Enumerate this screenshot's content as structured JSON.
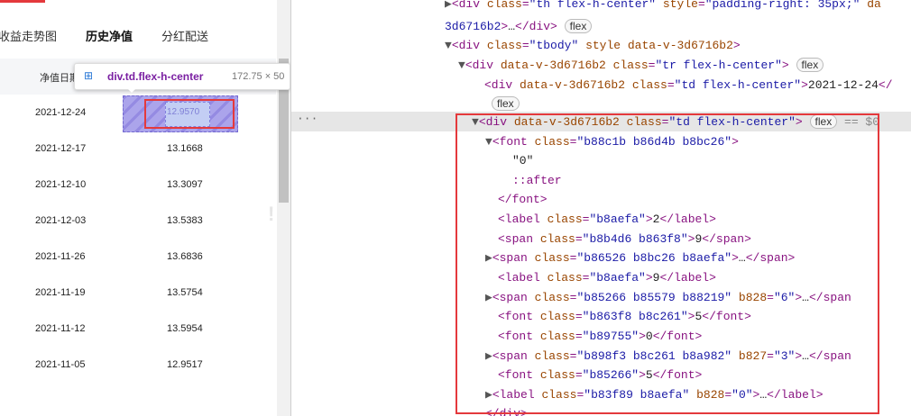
{
  "tabs": [
    "收益走势图",
    "历史净值",
    "分红配送"
  ],
  "table": {
    "header_date": "净值日期",
    "rows": [
      {
        "date": "2021-12-24",
        "value": "12.9570"
      },
      {
        "date": "2021-12-17",
        "value": "13.1668"
      },
      {
        "date": "2021-12-10",
        "value": "13.3097"
      },
      {
        "date": "2021-12-03",
        "value": "13.5383"
      },
      {
        "date": "2021-11-26",
        "value": "13.6836"
      },
      {
        "date": "2021-11-19",
        "value": "13.5754"
      },
      {
        "date": "2021-11-12",
        "value": "13.5954"
      },
      {
        "date": "2021-11-05",
        "value": "12.9517"
      }
    ]
  },
  "tooltip": {
    "name": "div.td.flex-h-center",
    "size": "172.75 × 50"
  },
  "devtools": {
    "badge": "flex",
    "eq": "== $0"
  }
}
